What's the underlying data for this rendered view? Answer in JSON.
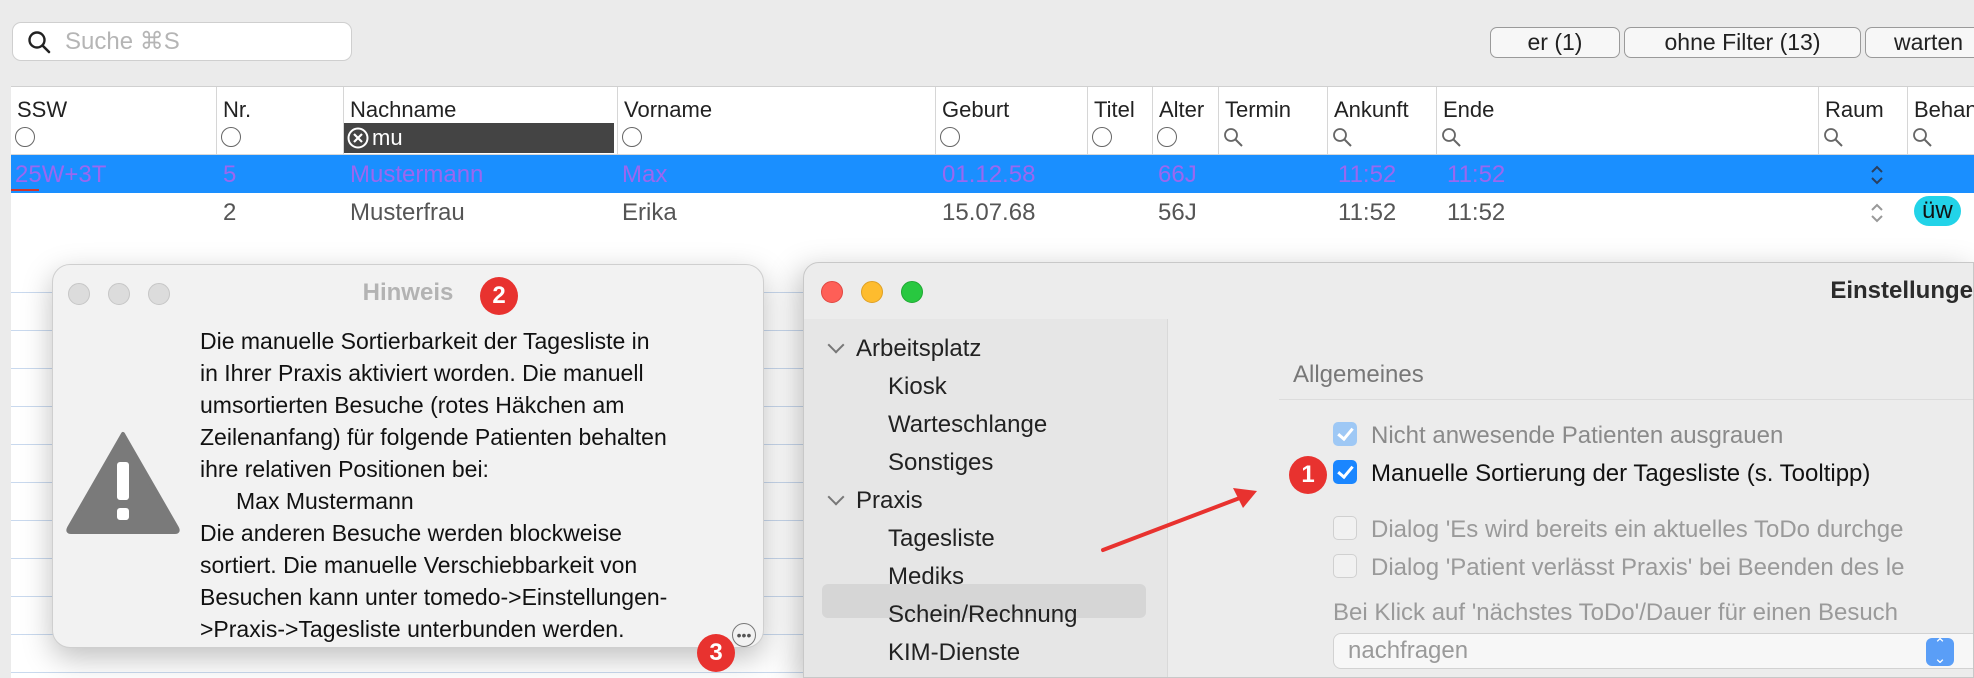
{
  "search": {
    "placeholder": "Suche ⌘S"
  },
  "toolbar": {
    "buttons": [
      "er (1)",
      "ohne Filter (13)",
      "warten"
    ]
  },
  "table": {
    "columns": [
      "SSW",
      "Nr.",
      "Nachname",
      "Vorname",
      "Geburt",
      "Titel",
      "Alter",
      "Termin",
      "Ankunft",
      "Ende",
      "Raum",
      "Behan"
    ],
    "nachname_filter": "mu",
    "rows": [
      {
        "ssw": "25W+3T",
        "nr": "5",
        "nachname": "Mustermann",
        "vorname": "Max",
        "geburt": "01.12.58",
        "alter": "66J",
        "ankunft": "11:52",
        "ende": "11:52"
      },
      {
        "ssw": "",
        "nr": "2",
        "nachname": "Musterfrau",
        "vorname": "Erika",
        "geburt": "15.07.68",
        "alter": "56J",
        "ankunft": "11:52",
        "ende": "11:52",
        "badge": "üw"
      }
    ]
  },
  "hinweis": {
    "title": "Hinweis",
    "lines": [
      "Die manuelle Sortierbarkeit der Tagesliste in",
      "in Ihrer Praxis aktiviert worden. Die manuell",
      "umsortierten Besuche (rotes Häkchen am",
      "Zeilenanfang) für folgende Patienten behalten",
      "ihre relativen Positionen bei:",
      "Max Mustermann",
      "Die anderen Besuche werden blockweise",
      "sortiert. Die manuelle Verschiebbarkeit von",
      "Besuchen kann unter tomedo->Einstellungen-",
      ">Praxis->Tagesliste unterbunden werden."
    ]
  },
  "annotations": [
    "1",
    "2",
    "3"
  ],
  "settings": {
    "title": "Einstellunge",
    "sidebar": [
      {
        "label": "Arbeitsplatz",
        "group": true
      },
      {
        "label": "Kiosk"
      },
      {
        "label": "Warteschlange"
      },
      {
        "label": "Sonstiges"
      },
      {
        "label": "Praxis",
        "group": true
      },
      {
        "label": "Tagesliste",
        "selected": true
      },
      {
        "label": "Mediks"
      },
      {
        "label": "Schein/Rechnung"
      },
      {
        "label": "KIM-Dienste"
      }
    ],
    "section": "Allgemeines",
    "options": [
      {
        "label": "Nicht anwesende Patienten ausgrauen",
        "checked": true,
        "dimmed": true
      },
      {
        "label": "Manuelle Sortierung der Tagesliste (s. Tooltipp)",
        "checked": true
      },
      {
        "label": "Dialog 'Es wird bereits ein aktuelles ToDo durchge",
        "checked": false
      },
      {
        "label": "Dialog 'Patient verlässt Praxis' bei Beenden des le",
        "checked": false
      }
    ],
    "click_label": "Bei Klick auf 'nächstes ToDo'/Dauer für einen Besuch",
    "popup_value": "nachfragen"
  },
  "colors": {
    "selection": "#1a8fff",
    "accent": "#1a86ff",
    "annotation": "#e8322f",
    "badge": "#22d3e8"
  }
}
